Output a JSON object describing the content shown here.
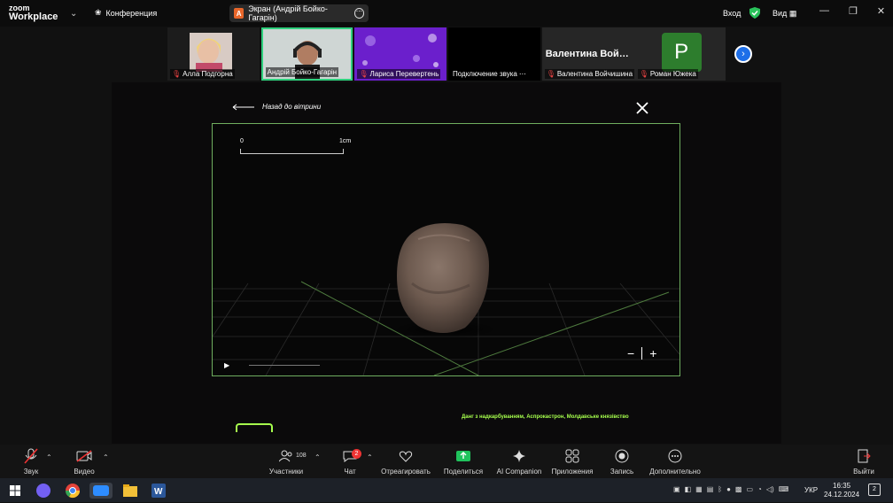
{
  "app": {
    "brand_line1": "zoom",
    "brand_line2": "Workplace",
    "conference_label": "Конференция"
  },
  "share": {
    "avatar_letter": "A",
    "label": "Экран (Андрій Бойко-Гагарін)"
  },
  "header": {
    "login": "Вход",
    "view": "Вид"
  },
  "participants": [
    {
      "name": "Алла Подгорна",
      "muted": true
    },
    {
      "name": "Андрій Бойко-Гагарін",
      "muted": false
    },
    {
      "name": "Лариса Перевертень",
      "muted": true
    },
    {
      "name": "Подключение звука",
      "muted": false
    },
    {
      "name": "Валентина Войчишина",
      "muted": true,
      "display": "Валентина Вой…"
    },
    {
      "name": "Роман Южека",
      "muted": true,
      "avatar_letter": "Р"
    }
  ],
  "viewer": {
    "back_label": "Назад до вітрини",
    "scale_start": "0",
    "scale_end": "1cm",
    "zoom_out": "−",
    "zoom_in": "+",
    "caption": "Данг з надкарбуванням, Аспрокастрон, Молдавське князівство"
  },
  "toolbar": {
    "audio": "Звук",
    "video": "Видео",
    "participants": "Участники",
    "participants_count": "108",
    "chat": "Чат",
    "chat_badge": "2",
    "react": "Отреагировать",
    "share": "Поделиться",
    "ai": "AI Companion",
    "apps": "Приложения",
    "record": "Запись",
    "more": "Дополнительно",
    "leave": "Выйти"
  },
  "taskbar": {
    "lang": "УКР",
    "time": "16:35",
    "date": "24.12.2024",
    "notif": "2"
  },
  "colors": {
    "accent_green": "#a6ff4d",
    "speaker_border": "#2fd07d",
    "zoom_blue": "#1e6fe8"
  }
}
